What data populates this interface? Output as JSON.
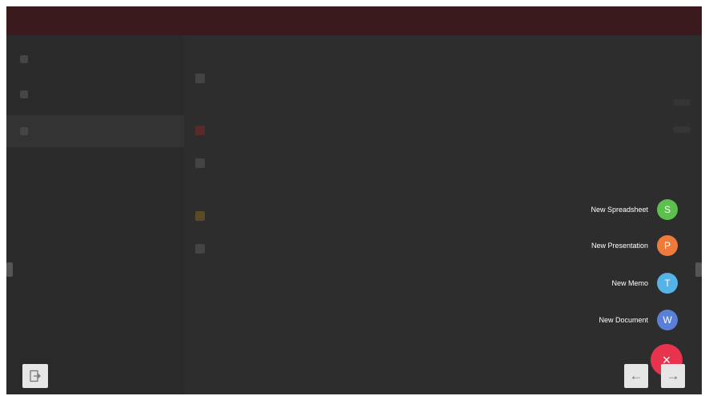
{
  "window": {
    "title": "",
    "topbar_color": "#3a1a1c"
  },
  "sidebar": {
    "items": [
      {
        "label": "",
        "icon": "grid-icon"
      },
      {
        "label": "",
        "icon": "star-icon"
      },
      {
        "label": "",
        "icon": "folder-icon"
      }
    ]
  },
  "main": {
    "sections": [
      {
        "heading": "",
        "items": [
          {
            "label": "",
            "icon": "file-icon"
          }
        ]
      },
      {
        "heading": "",
        "items": [
          {
            "label": "",
            "icon": "file-red-icon"
          },
          {
            "label": "",
            "icon": "file-gray-icon"
          }
        ]
      },
      {
        "heading": "",
        "items": [
          {
            "label": "",
            "icon": "folder-amber-icon"
          },
          {
            "label": "",
            "icon": "folder-gray-icon"
          }
        ]
      }
    ]
  },
  "fab_menu": {
    "items": [
      {
        "label": "New Spreadsheet",
        "letter": "S",
        "color": "#5cbf4e",
        "icon": "spreadsheet-icon"
      },
      {
        "label": "New Presentation",
        "letter": "P",
        "color": "#ee7a3c",
        "icon": "presentation-icon"
      },
      {
        "label": "New Memo",
        "letter": "T",
        "color": "#55b3e8",
        "icon": "memo-icon"
      },
      {
        "label": "New Document",
        "letter": "W",
        "color": "#5a7fd6",
        "icon": "document-icon"
      }
    ],
    "main": {
      "symbol": "×",
      "color": "#e8334f",
      "icon": "close-icon"
    }
  },
  "nav": {
    "back_symbol": "←",
    "forward_symbol": "→",
    "exit_icon": "exit-icon"
  }
}
